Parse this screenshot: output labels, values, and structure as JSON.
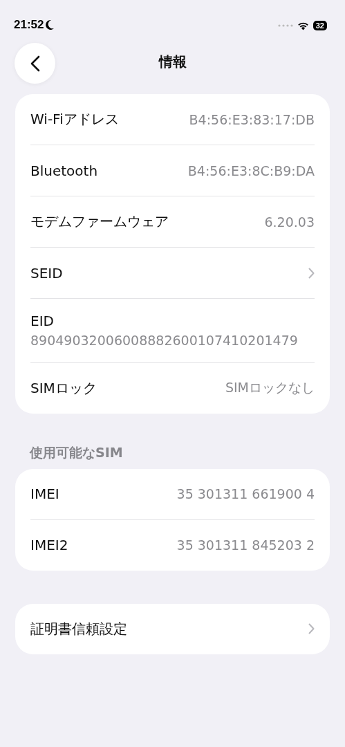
{
  "status_bar": {
    "time": "21:52",
    "focus_moon": true,
    "battery": "32"
  },
  "nav": {
    "title": "情報"
  },
  "sections": [
    {
      "rows": [
        {
          "kind": "value",
          "label": "Wi-Fiアドレス",
          "value": "B4:56:E3:83:17:DB"
        },
        {
          "kind": "value",
          "label": "Bluetooth",
          "value": "B4:56:E3:8C:B9:DA"
        },
        {
          "kind": "value",
          "label": "モデムファームウェア",
          "value": "6.20.03"
        },
        {
          "kind": "chevron",
          "label": "SEID"
        },
        {
          "kind": "stacked",
          "label": "EID",
          "value": "89049032006008882600107410201479"
        },
        {
          "kind": "value",
          "label": "SIMロック",
          "value": "SIMロックなし"
        }
      ]
    },
    {
      "header": "使用可能なSIM",
      "rows": [
        {
          "kind": "value",
          "label": "IMEI",
          "value": "35 301311 661900 4"
        },
        {
          "kind": "value",
          "label": "IMEI2",
          "value": "35 301311 845203 2"
        }
      ]
    },
    {
      "rows": [
        {
          "kind": "chevron",
          "label": "証明書信頼設定"
        }
      ]
    }
  ]
}
